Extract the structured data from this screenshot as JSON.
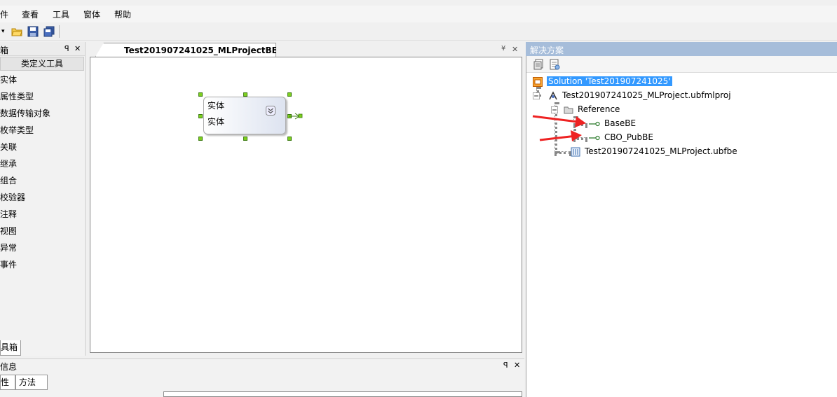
{
  "menu": [
    "件",
    "查看",
    "工具",
    "窗体",
    "帮助"
  ],
  "toolbox": {
    "title": "箱",
    "pin": " ",
    "group": "类定义工具",
    "items": [
      "实体",
      "属性类型",
      "数据传输对象",
      "枚举类型",
      "关联",
      "继承",
      "组合",
      "校验器",
      "注释",
      "视图",
      "异常",
      "事件"
    ],
    "bottom_tab": "具箱"
  },
  "document": {
    "tab_label": "Test201907241025_MLProjectBE",
    "entity": {
      "title": "实体",
      "subtitle": "实体"
    }
  },
  "solution": {
    "title": "解决方案",
    "root": "Solution 'Test201907241025'",
    "project": "Test201907241025_MLProject.ubfmlproj",
    "reference_folder": "Reference",
    "references": [
      "BaseBE",
      "CBO_PubBE"
    ],
    "be_file": "Test201907241025_MLProject.ubfbe"
  },
  "info_panel": {
    "title": "信息",
    "tabs": [
      "性",
      "方法"
    ]
  },
  "colors": {
    "accent_selected": "#3399ff",
    "panel_header": "#a6bdda",
    "handle": "#7dcf1e",
    "arrow": "#ee2222"
  }
}
